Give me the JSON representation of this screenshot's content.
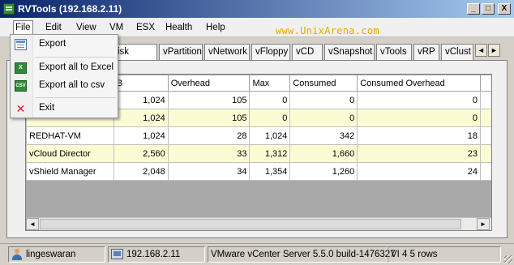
{
  "window": {
    "title": "RVTools (192.168.2.11)",
    "minimize": "_",
    "maximize": "□",
    "close": "X"
  },
  "menu": [
    "File",
    "Edit",
    "View",
    "VM",
    "ESX",
    "Health",
    "Help"
  ],
  "brand": "www.UnixArena.com",
  "tabs": [
    "isk",
    "vPartition",
    "vNetwork",
    "vFloppy",
    "vCD",
    "vSnapshot",
    "vTools",
    "vRP",
    "vClust"
  ],
  "tab_scroll": [
    "◄",
    "►"
  ],
  "table": {
    "columns": [
      "B",
      "Overhead",
      "Max",
      "Consumed",
      "Consumed Overhead"
    ],
    "rows": [
      {
        "name": "",
        "mb": "1,024",
        "overhead": "105",
        "max": "0",
        "consumed": "0",
        "consumed_overhead": "0"
      },
      {
        "name": "",
        "mb": "1,024",
        "overhead": "105",
        "max": "0",
        "consumed": "0",
        "consumed_overhead": "0"
      },
      {
        "name": "REDHAT-VM",
        "mb": "1,024",
        "overhead": "28",
        "max": "1,024",
        "consumed": "342",
        "consumed_overhead": "18"
      },
      {
        "name": "vCloud Director",
        "mb": "2,560",
        "overhead": "33",
        "max": "1,312",
        "consumed": "1,660",
        "consumed_overhead": "23"
      },
      {
        "name": "vShield Manager",
        "mb": "2,048",
        "overhead": "34",
        "max": "1,354",
        "consumed": "1,260",
        "consumed_overhead": "24"
      }
    ]
  },
  "scroll_arrows": [
    "◄",
    "►"
  ],
  "file_menu": {
    "items": [
      {
        "label": "Export",
        "icon": "export-icon"
      },
      {
        "label": "Export all to Excel",
        "icon": "excel-icon",
        "icon_text": "X"
      },
      {
        "label": "Export all to csv",
        "icon": "csv-icon",
        "icon_text": "CSV"
      },
      {
        "label": "Exit",
        "icon": "exit-icon",
        "icon_text": "✕"
      }
    ]
  },
  "status": {
    "user": "lingeswaran",
    "host": "192.168.2.11",
    "server": "VMware vCenter Server 5.5.0 build-1476327",
    "rows": "VI 4 5 rows"
  },
  "colors": {
    "title_gradient_start": "#0a246a",
    "title_gradient_end": "#a6caf0",
    "alt_row": "#fcfcd4",
    "brand": "#e6a800"
  }
}
